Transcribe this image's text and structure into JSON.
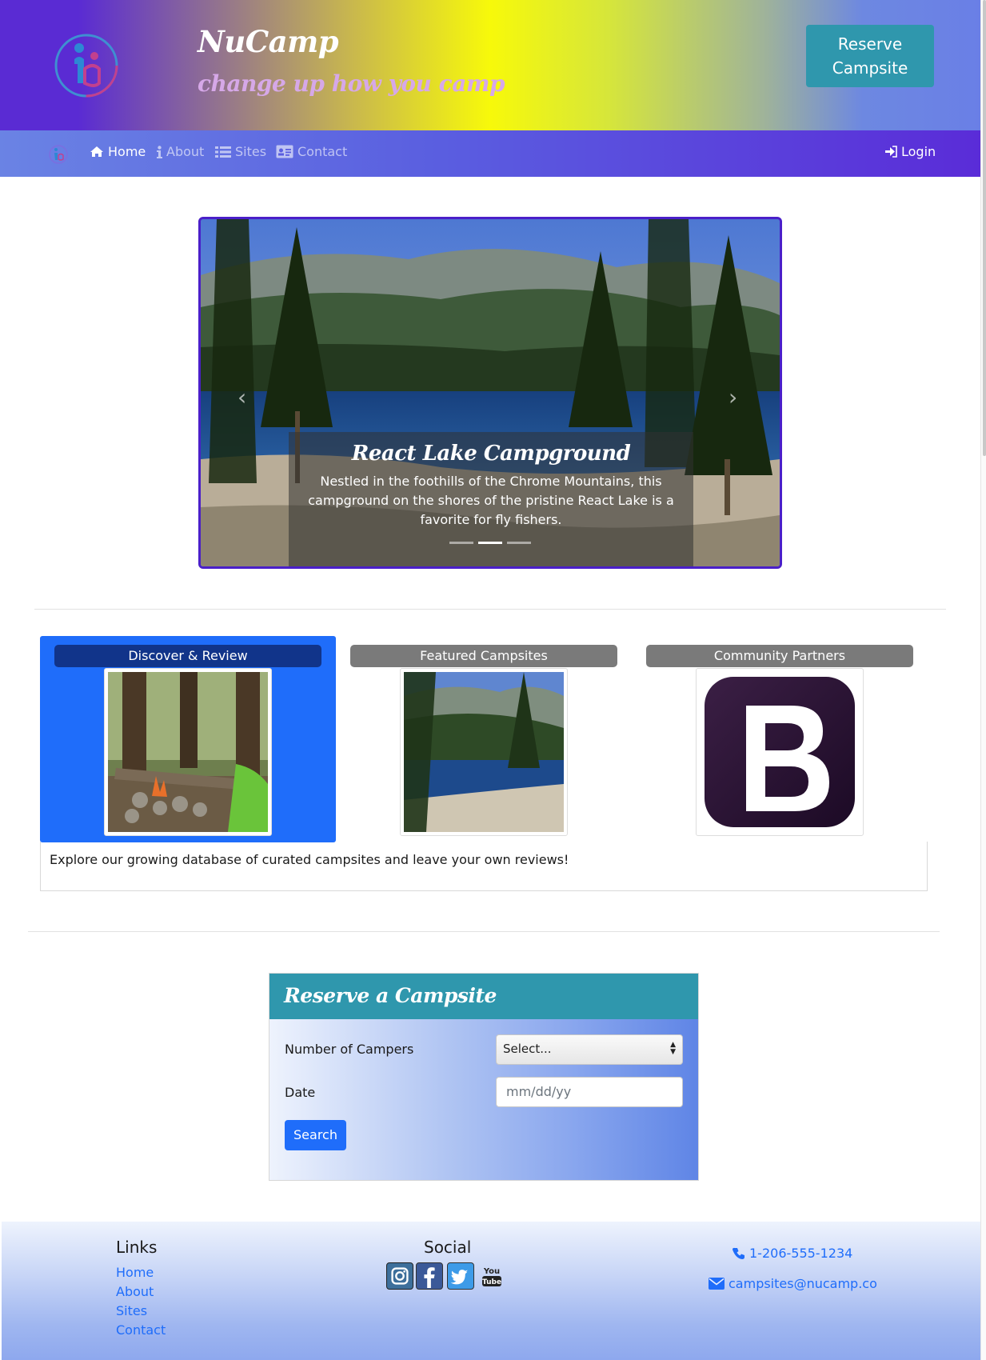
{
  "header": {
    "brand_title": "NuCamp",
    "brand_subtitle": "change up how you camp",
    "reserve_button": "Reserve Campsite"
  },
  "nav": {
    "items": [
      {
        "label": "Home",
        "icon": "home-icon",
        "active": true
      },
      {
        "label": "About",
        "icon": "info-icon",
        "active": false
      },
      {
        "label": "Sites",
        "icon": "list-icon",
        "active": false
      },
      {
        "label": "Contact",
        "icon": "address-card-icon",
        "active": false
      }
    ],
    "login": "Login"
  },
  "carousel": {
    "title": "React Lake Campground",
    "text": "Nestled in the foothills of the Chrome Mountains, this campground on the shores of the pristine React Lake is a favorite for fly fishers.",
    "slides": 3,
    "active_slide": 2
  },
  "tabs": {
    "items": [
      {
        "label": "Discover & Review",
        "active": true
      },
      {
        "label": "Featured Campsites",
        "active": false
      },
      {
        "label": "Community Partners",
        "active": false
      }
    ],
    "content": "Explore our growing database of curated campsites and leave your own reviews!"
  },
  "reserve_form": {
    "title": "Reserve a Campsite",
    "campers_label": "Number of Campers",
    "campers_value": "Select...",
    "date_label": "Date",
    "date_placeholder": "mm/dd/yy",
    "search_button": "Search"
  },
  "footer": {
    "links_heading": "Links",
    "links": [
      "Home",
      "About",
      "Sites",
      "Contact"
    ],
    "social_heading": "Social",
    "social": [
      "instagram-icon",
      "facebook-icon",
      "twitter-icon",
      "youtube-icon"
    ],
    "phone": "1-206-555-1234",
    "email": "campsites@nucamp.co"
  },
  "colors": {
    "accent": "#2f97ad",
    "primary": "#1f6dfa",
    "nav_purple": "#5a2cd8"
  }
}
